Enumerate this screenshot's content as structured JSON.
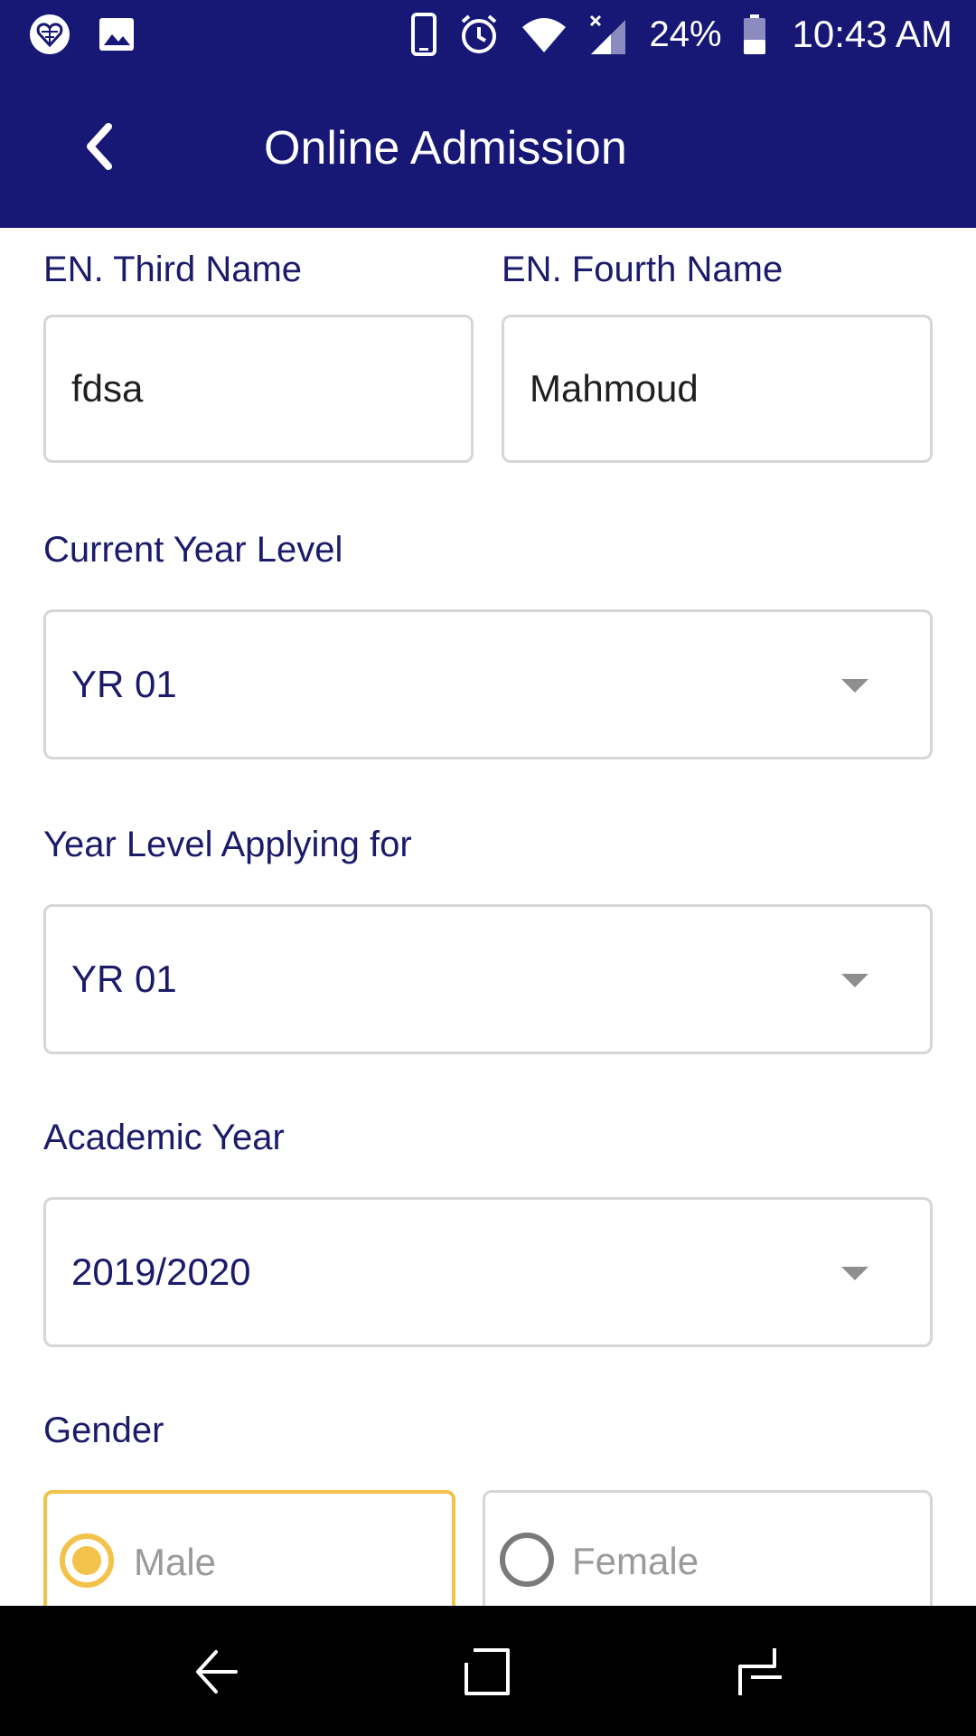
{
  "status_bar": {
    "battery_percent": "24%",
    "time": "10:43 AM",
    "icons": [
      "app-notification-icon",
      "image-icon",
      "phone-icon",
      "alarm-icon",
      "wifi-icon",
      "signal-icon",
      "battery-icon"
    ]
  },
  "app_bar": {
    "title": "Online Admission",
    "back_icon": "chevron-left-icon",
    "background_color": "#171775"
  },
  "form": {
    "third_name": {
      "label": "EN. Third Name",
      "value": "fdsa"
    },
    "fourth_name": {
      "label": "EN. Fourth Name",
      "value": "Mahmoud"
    },
    "current_year_level": {
      "label": "Current Year Level",
      "value": "YR 01"
    },
    "year_level_applying": {
      "label": "Year Level Applying for",
      "value": "YR 01"
    },
    "academic_year": {
      "label": "Academic Year",
      "value": "2019/2020"
    },
    "gender": {
      "label": "Gender",
      "options": [
        {
          "label": "Male",
          "selected": true
        },
        {
          "label": "Female",
          "selected": false
        }
      ],
      "accent_color": "#f3c24a"
    }
  },
  "nav_bar": {
    "buttons": [
      "back-nav-icon",
      "home-nav-icon",
      "recents-nav-icon"
    ]
  }
}
